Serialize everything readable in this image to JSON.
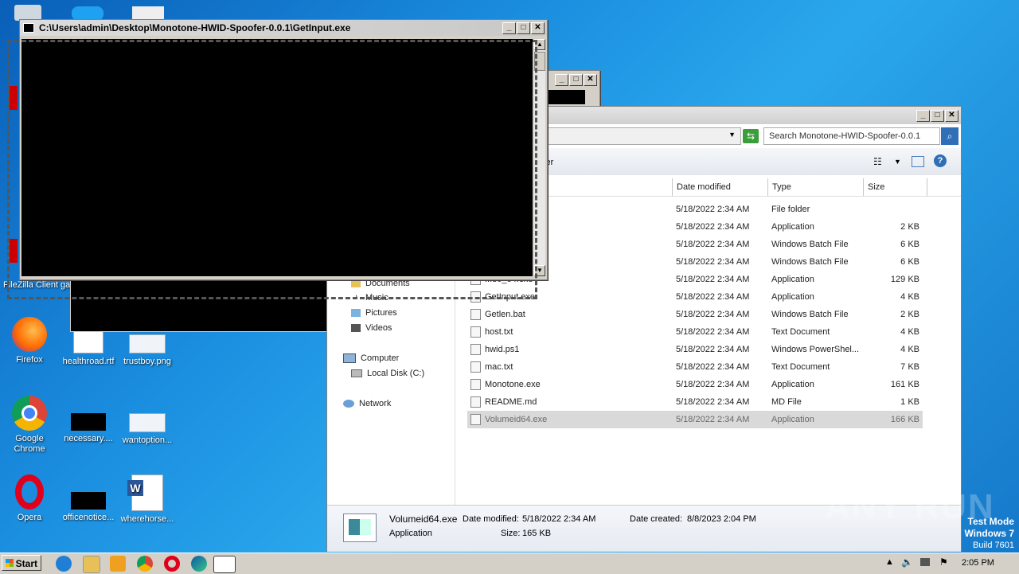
{
  "desktop": {
    "icons": [
      {
        "label": "Firefox"
      },
      {
        "label": "healthroad.rtf"
      },
      {
        "label": "trustboy.png"
      },
      {
        "label": "Google Chrome"
      },
      {
        "label": "necessary...."
      },
      {
        "label": "wantoption..."
      },
      {
        "label": "Opera"
      },
      {
        "label": "officenotice..."
      },
      {
        "label": "wherehorse..."
      },
      {
        "label": "FileZilla Client"
      },
      {
        "label": "ga"
      }
    ],
    "watermark": {
      "brand": "ANY RUN",
      "line1": "Test Mode",
      "line2": "Windows 7",
      "line3": "Build 7601"
    }
  },
  "console_window": {
    "title": "C:\\Users\\admin\\Desktop\\Monotone-HWID-Spoofer-0.0.1\\GetInput.exe"
  },
  "explorer": {
    "search_placeholder": "Search Monotone-HWID-Spoofer-0.0.1",
    "toolbar_partial": "lder",
    "columns": {
      "name": "",
      "date": "Date modified",
      "type": "Type",
      "size": "Size"
    },
    "nav": [
      {
        "label": "Documents"
      },
      {
        "label": "Music"
      },
      {
        "label": "Pictures"
      },
      {
        "label": "Videos"
      },
      {
        "label": "Computer"
      },
      {
        "label": "Local Disk (C:)"
      },
      {
        "label": "Network"
      }
    ],
    "files": [
      {
        "name": "",
        "date": "5/18/2022 2:34 AM",
        "type": "File folder",
        "size": ""
      },
      {
        "name": "",
        "date": "5/18/2022 2:34 AM",
        "type": "Application",
        "size": "2 KB"
      },
      {
        "name": "",
        "date": "5/18/2022 2:34 AM",
        "type": "Windows Batch File",
        "size": "6 KB"
      },
      {
        "name": "",
        "date": "5/18/2022 2:34 AM",
        "type": "Windows Batch File",
        "size": "6 KB"
      },
      {
        "name": "...86_64.exe",
        "date": "5/18/2022 2:34 AM",
        "type": "Application",
        "size": "129 KB"
      },
      {
        "name": "GetInput.exe",
        "date": "5/18/2022 2:34 AM",
        "type": "Application",
        "size": "4 KB"
      },
      {
        "name": "Getlen.bat",
        "date": "5/18/2022 2:34 AM",
        "type": "Windows Batch File",
        "size": "2 KB"
      },
      {
        "name": "host.txt",
        "date": "5/18/2022 2:34 AM",
        "type": "Text Document",
        "size": "4 KB"
      },
      {
        "name": "hwid.ps1",
        "date": "5/18/2022 2:34 AM",
        "type": "Windows PowerShel...",
        "size": "4 KB"
      },
      {
        "name": "mac.txt",
        "date": "5/18/2022 2:34 AM",
        "type": "Text Document",
        "size": "7 KB"
      },
      {
        "name": "Monotone.exe",
        "date": "5/18/2022 2:34 AM",
        "type": "Application",
        "size": "161 KB"
      },
      {
        "name": "README.md",
        "date": "5/18/2022 2:34 AM",
        "type": "MD File",
        "size": "1 KB"
      },
      {
        "name": "Volumeid64.exe",
        "date": "5/18/2022 2:34 AM",
        "type": "Application",
        "size": "166 KB"
      }
    ],
    "details": {
      "name": "Volumeid64.exe",
      "type": "Application",
      "date_modified_label": "Date modified:",
      "date_modified": "5/18/2022 2:34 AM",
      "date_created_label": "Date created:",
      "date_created": "8/8/2023 2:04 PM",
      "size_label": "Size:",
      "size": "165 KB"
    }
  },
  "taskbar": {
    "start": "Start",
    "clock": "2:05 PM"
  }
}
